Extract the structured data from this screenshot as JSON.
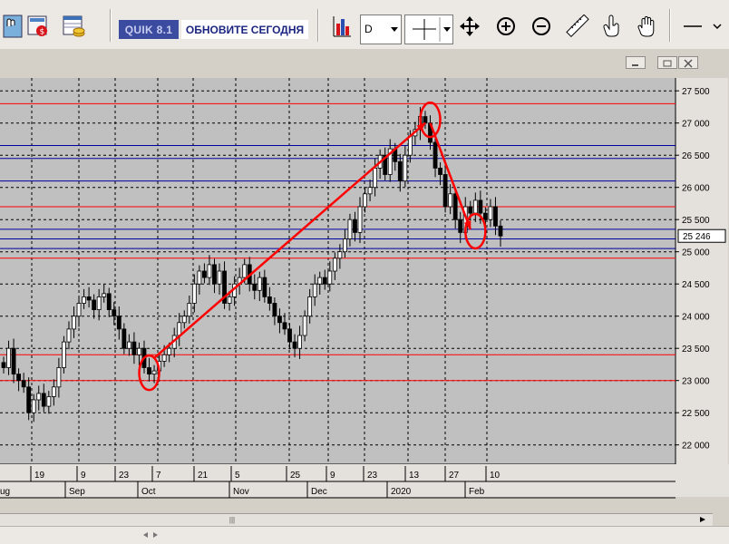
{
  "toolbar": {
    "quik_badge": "QUIK 8.1",
    "update_link": "ОБНОВИТЕ СЕГОДНЯ",
    "interval_value": "D"
  },
  "colors": {
    "chart_bg": "#c0c0c0",
    "grid": "#000000",
    "red_level": "#ff0000",
    "blue_level": "#0000a0",
    "annotation": "#ff0000",
    "candle": "#000000"
  },
  "chart_data": {
    "type": "candlestick",
    "interval": "D",
    "ylim": [
      21700,
      27700
    ],
    "y_ticks": [
      "27 500",
      "27 000",
      "26 500",
      "26 000",
      "25 500",
      "25 000",
      "24 500",
      "24 000",
      "23 500",
      "23 000",
      "22 500",
      "22 000"
    ],
    "current_price_label": "25 246",
    "current_price": 25246,
    "red_levels": [
      27300,
      25700,
      24900,
      23400,
      23000
    ],
    "blue_levels": [
      26650,
      26450,
      26100,
      25350,
      25200,
      25050
    ],
    "day_labels": [
      "19",
      "9",
      "23",
      "7",
      "21",
      "5",
      "25",
      "9",
      "23",
      "13",
      "27",
      "10"
    ],
    "month_labels": [
      "ug",
      "Sep",
      "Oct",
      "Nov",
      "Dec",
      "2020",
      "Feb"
    ],
    "closes": [
      23200,
      23500,
      23100,
      23000,
      22900,
      22500,
      22700,
      22800,
      22600,
      22750,
      22900,
      23200,
      23600,
      23800,
      24000,
      24200,
      24300,
      24250,
      24100,
      24300,
      24350,
      24100,
      24000,
      23800,
      23500,
      23600,
      23400,
      23500,
      23200,
      23100,
      23150,
      23300,
      23400,
      23500,
      23700,
      23900,
      24000,
      24200,
      24500,
      24700,
      24600,
      24800,
      24500,
      24700,
      24200,
      24300,
      24500,
      24600,
      24800,
      24500,
      24400,
      24600,
      24300,
      24200,
      24000,
      23900,
      23800,
      23600,
      23500,
      23700,
      24000,
      24300,
      24500,
      24600,
      24500,
      24700,
      24900,
      25000,
      25200,
      25500,
      25300,
      25700,
      25900,
      26000,
      26300,
      26500,
      26200,
      26600,
      26400,
      26100,
      26500,
      26800,
      26900,
      27100,
      27000,
      26700,
      26300,
      26200,
      25700,
      25900,
      25500,
      25300,
      25700,
      25600,
      25800,
      25600,
      25500,
      25700,
      25400,
      25246
    ],
    "annotations": [
      {
        "kind": "arrow",
        "from_date_index": 30,
        "from_price": 23350,
        "to_date_index": 84,
        "to_price": 27000
      },
      {
        "kind": "arrow",
        "from_date_index": 85,
        "from_price": 27000,
        "to_date_index": 93,
        "to_price": 25350
      },
      {
        "kind": "circle",
        "date_index": 29,
        "price": 23120
      },
      {
        "kind": "circle",
        "date_index": 85,
        "price": 27050
      },
      {
        "kind": "circle",
        "date_index": 94,
        "price": 25320
      }
    ]
  }
}
